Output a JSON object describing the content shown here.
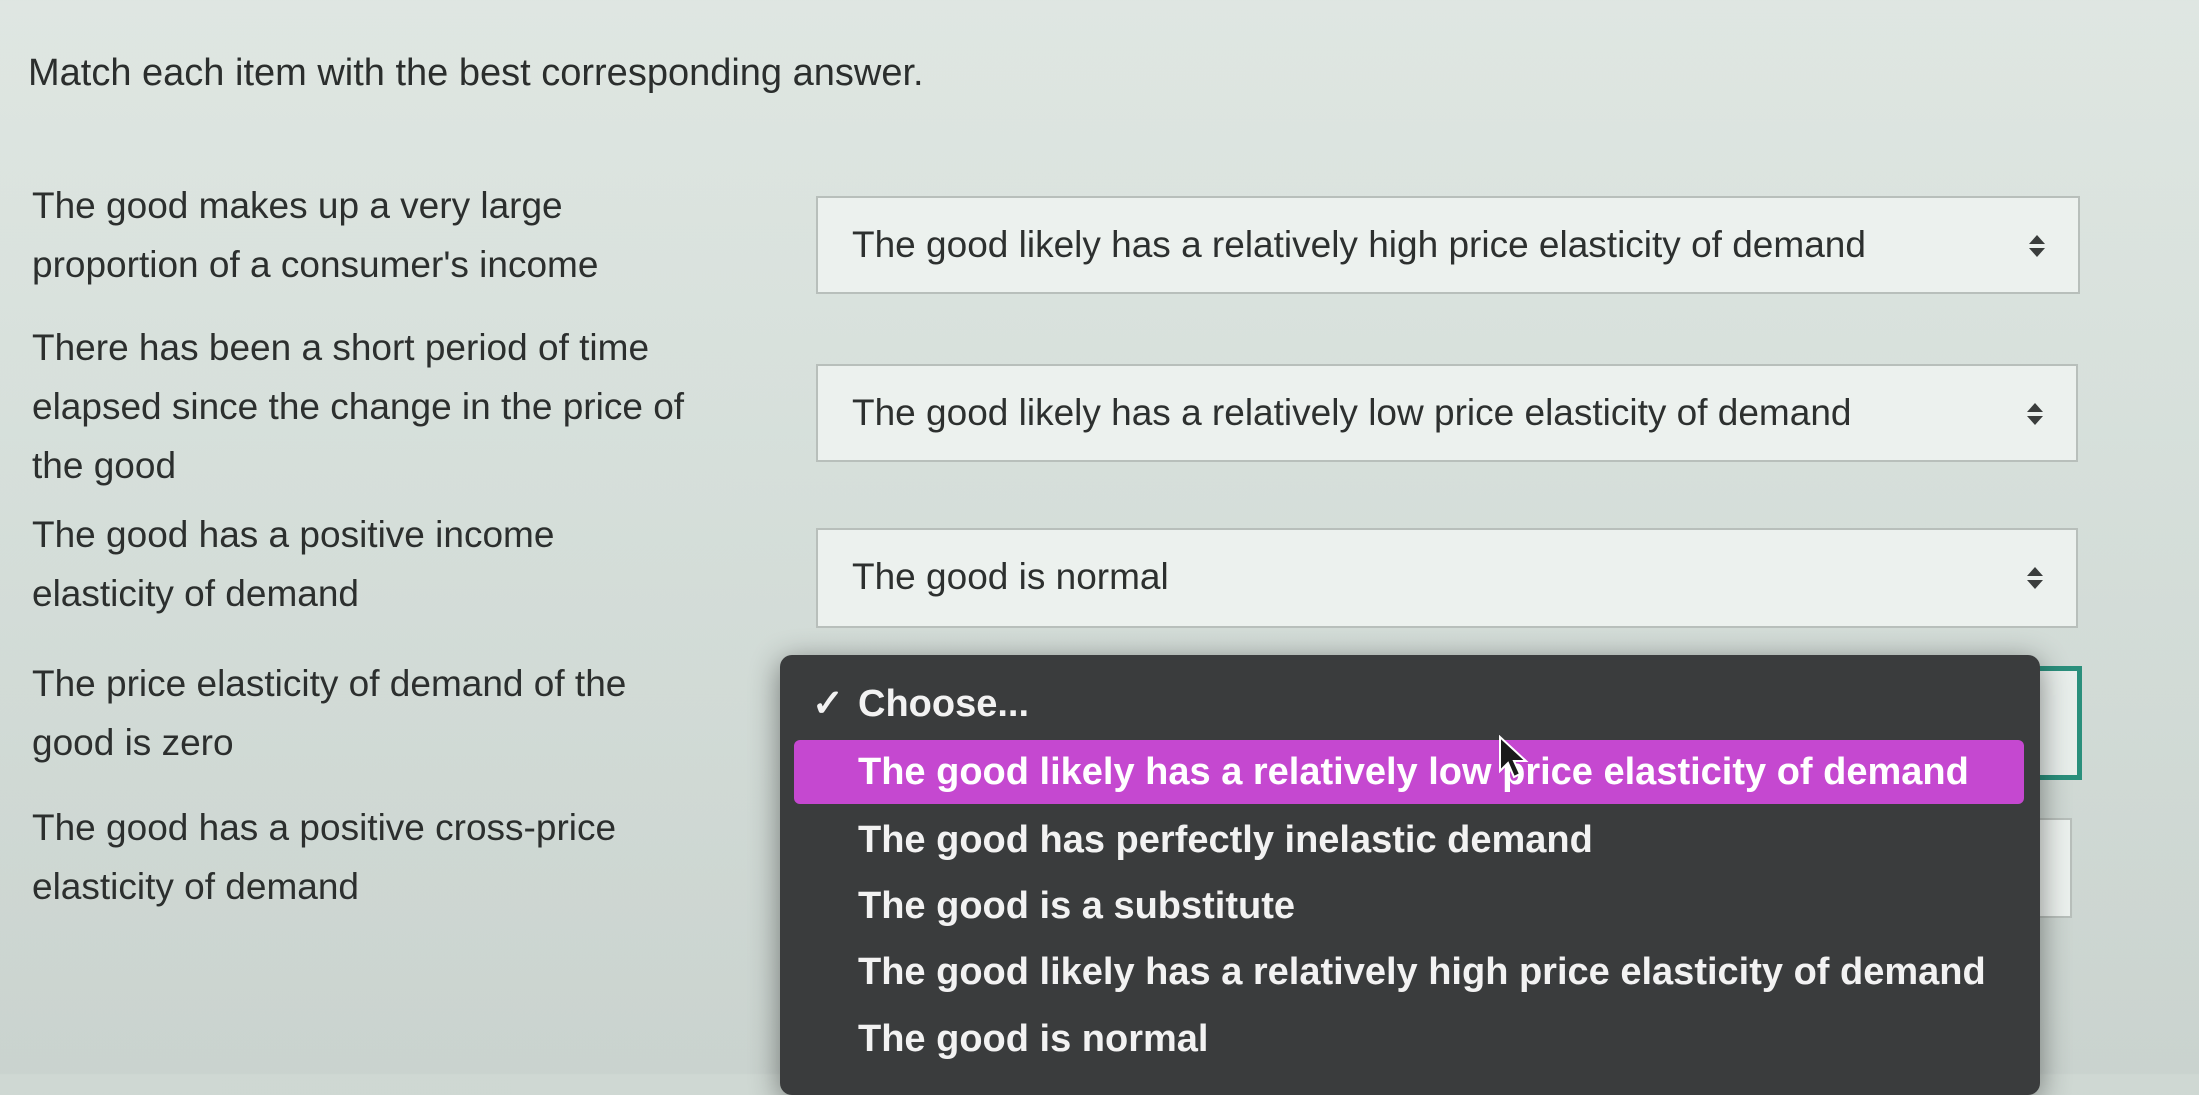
{
  "instructions": "Match each item with the best corresponding answer.",
  "items": [
    {
      "lines": [
        "The good makes up a very large",
        "proportion of a consumer's income"
      ]
    },
    {
      "lines": [
        "There has been a short period of time",
        "elapsed since the change in the price of",
        "the good"
      ]
    },
    {
      "lines": [
        "The good has a positive income",
        "elasticity of demand"
      ]
    },
    {
      "lines": [
        "The price elasticity of demand of the",
        "good is zero"
      ]
    },
    {
      "lines": [
        "The good has a positive cross-price",
        "elasticity of demand"
      ]
    }
  ],
  "selects": [
    {
      "value": "The good likely has a relatively high price elasticity of demand"
    },
    {
      "value": "The good likely has a relatively low price elasticity of demand"
    },
    {
      "value": "The good is normal"
    },
    {
      "value": ""
    },
    {
      "value": ""
    }
  ],
  "dropdown": {
    "check_mark": "✓",
    "options": [
      "Choose...",
      "The good likely has a relatively low price elasticity of demand",
      "The good has perfectly inelastic demand",
      "The good is a substitute",
      "The good likely has a relatively high price elasticity of demand",
      "The good is normal"
    ],
    "selected_index": 0,
    "highlighted_index": 1
  },
  "colors": {
    "highlight": "#c548d0",
    "focus_border": "#2a8f7c",
    "dropdown_bg": "#3a3c3d"
  }
}
